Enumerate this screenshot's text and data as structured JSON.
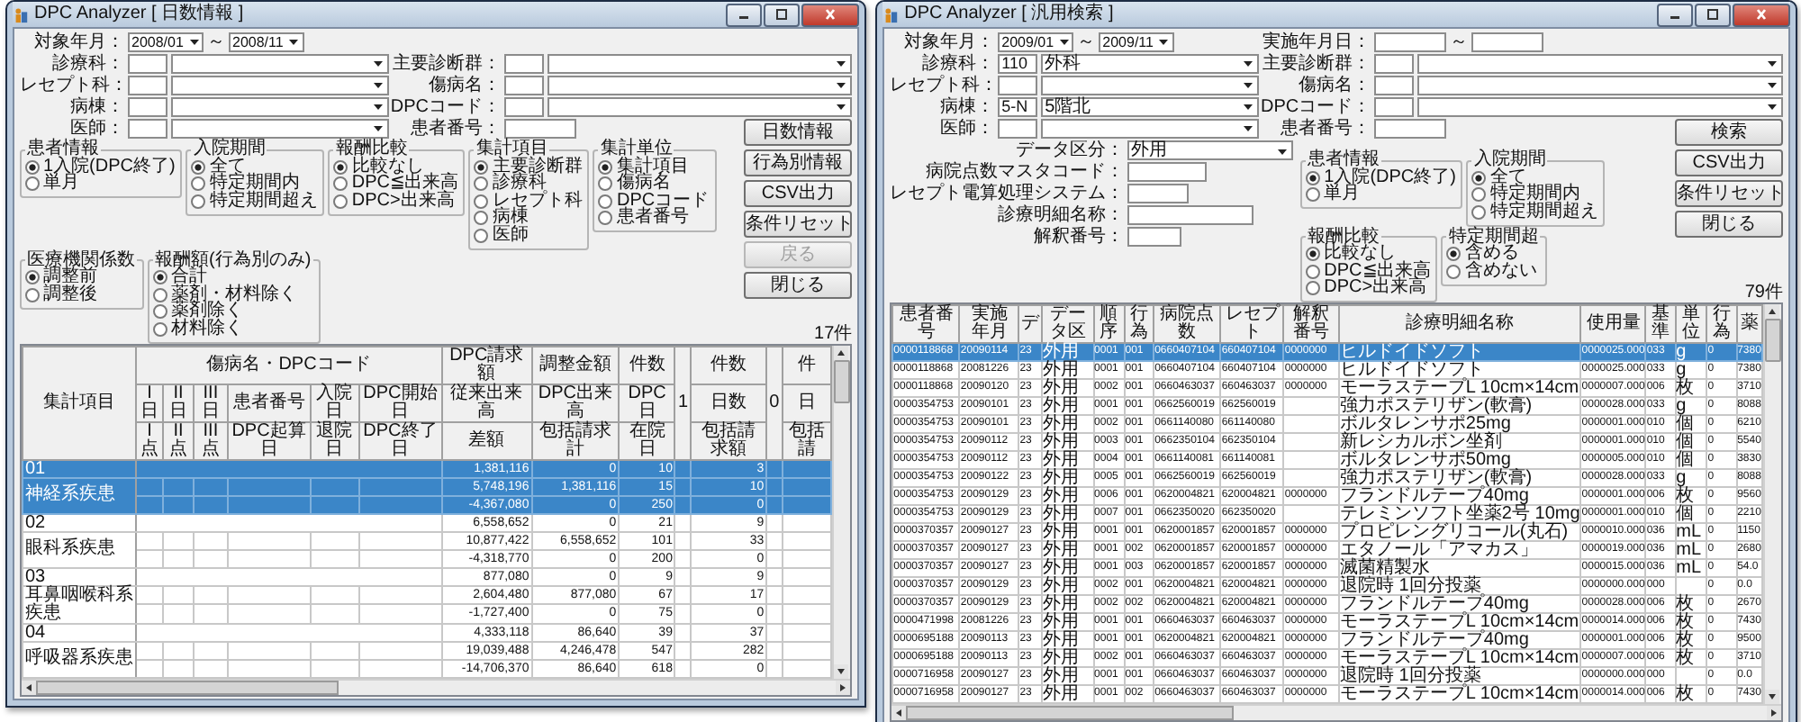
{
  "windows": [
    {
      "title": "DPC Analyzer [ 日数情報 ]",
      "period": {
        "label": "対象年月：",
        "from": "2008/01",
        "sep": "～",
        "to": "2008/11"
      },
      "field_rows": [
        [
          {
            "label": "診療科：",
            "kind": "code_select"
          },
          {
            "label": "主要診断群：",
            "kind": "code_select"
          }
        ],
        [
          {
            "label": "レセプト科：",
            "kind": "code_select"
          },
          {
            "label": "傷病名：",
            "kind": "code_select"
          }
        ],
        [
          {
            "label": "病棟：",
            "kind": "code_select"
          },
          {
            "label": "DPCコード：",
            "kind": "code_select"
          }
        ],
        [
          {
            "label": "医師：",
            "kind": "code_select"
          },
          {
            "label": "患者番号：",
            "kind": "text"
          }
        ]
      ],
      "groups": [
        {
          "title": "患者情報",
          "options": [
            {
              "label": "1入院(DPC終了)",
              "selected": true
            },
            {
              "label": "単月",
              "selected": false
            }
          ]
        },
        {
          "title": "入院期間",
          "options": [
            {
              "label": "全て",
              "selected": true
            },
            {
              "label": "特定期間内",
              "selected": false
            },
            {
              "label": "特定期間超え",
              "selected": false
            }
          ]
        },
        {
          "title": "報酬比較",
          "options": [
            {
              "label": "比較なし",
              "selected": true
            },
            {
              "label": "DPC≦出来高",
              "selected": false
            },
            {
              "label": "DPC>出来高",
              "selected": false
            }
          ]
        },
        {
          "title": "集計項目",
          "options": [
            {
              "label": "主要診断群",
              "selected": true
            },
            {
              "label": "診療科",
              "selected": false
            },
            {
              "label": "レセプト科",
              "selected": false
            },
            {
              "label": "病棟",
              "selected": false
            },
            {
              "label": "医師",
              "selected": false
            }
          ]
        },
        {
          "title": "集計単位",
          "options": [
            {
              "label": "集計項目",
              "selected": true
            },
            {
              "label": "傷病名",
              "selected": false
            },
            {
              "label": "DPCコード",
              "selected": false
            },
            {
              "label": "患者番号",
              "selected": false
            }
          ]
        },
        {
          "title": "医療機関係数",
          "options": [
            {
              "label": "調整前",
              "selected": true
            },
            {
              "label": "調整後",
              "selected": false
            }
          ]
        },
        {
          "title": "報酬額(行為別のみ)",
          "options": [
            {
              "label": "合計",
              "selected": true
            },
            {
              "label": "薬剤・材料除く",
              "selected": false
            },
            {
              "label": "薬剤除く",
              "selected": false
            },
            {
              "label": "材料除く",
              "selected": false
            }
          ]
        }
      ],
      "buttons": [
        {
          "label": "日数情報",
          "disabled": false
        },
        {
          "label": "行為別情報",
          "disabled": false
        },
        {
          "label": "CSV出力",
          "disabled": false
        },
        {
          "label": "条件リセット",
          "disabled": false
        },
        {
          "label": "戻る",
          "disabled": true
        },
        {
          "label": "閉じる",
          "disabled": false
        }
      ],
      "count": "17件",
      "table": {
        "kind": "summary",
        "header_rows": [
          [
            "集計項目",
            "傷病名・DPCコード",
            "DPC請求額",
            "調整金額",
            "件数",
            "1",
            "件数",
            "0",
            "件"
          ],
          [
            "I日",
            "II日",
            "III日",
            "患者番号",
            "入院日",
            "DPC開始日",
            "従来出来高",
            "DPC出来高",
            "DPC日",
            "日数",
            "日"
          ],
          [
            "I点",
            "II点",
            "III点",
            "DPC起算日",
            "退院日",
            "DPC終了日",
            "差額",
            "包括請求計",
            "在院日",
            "包括請求額",
            "包括請"
          ]
        ],
        "groups": [
          {
            "code": "01",
            "name": "神経系疾患",
            "selected": true,
            "rows": [
              [
                "1,381,116",
                "0",
                "10",
                "3"
              ],
              [
                "5,748,196",
                "1,381,116",
                "15",
                "10"
              ],
              [
                "-4,367,080",
                "0",
                "250",
                "0"
              ]
            ]
          },
          {
            "code": "02",
            "name": "眼科系疾患",
            "selected": false,
            "rows": [
              [
                "6,558,652",
                "0",
                "21",
                "9"
              ],
              [
                "10,877,422",
                "6,558,652",
                "101",
                "33"
              ],
              [
                "-4,318,770",
                "0",
                "200",
                "0"
              ]
            ]
          },
          {
            "code": "03",
            "name": "耳鼻咽喉科系疾患",
            "selected": false,
            "rows": [
              [
                "877,080",
                "0",
                "9",
                "9"
              ],
              [
                "2,604,480",
                "877,080",
                "67",
                "17"
              ],
              [
                "-1,727,400",
                "0",
                "75",
                "0"
              ]
            ]
          },
          {
            "code": "04",
            "name": "呼吸器系疾患",
            "selected": false,
            "rows": [
              [
                "4,333,118",
                "86,640",
                "39",
                "37"
              ],
              [
                "19,039,488",
                "4,246,478",
                "547",
                "282"
              ],
              [
                "-14,706,370",
                "86,640",
                "618",
                "0"
              ]
            ]
          }
        ]
      }
    },
    {
      "title": "DPC Analyzer [ 汎用検索 ]",
      "period": {
        "label": "対象年月：",
        "from": "2009/01",
        "sep": "～",
        "to": "2009/11"
      },
      "date_range": {
        "label": "実施年月日：",
        "sep": "～"
      },
      "field_rows": [
        [
          {
            "label": "診療科：",
            "kind": "code_select",
            "code": "110",
            "value": "外科"
          },
          {
            "label": "主要診断群：",
            "kind": "code_select"
          }
        ],
        [
          {
            "label": "レセプト科：",
            "kind": "code_select"
          },
          {
            "label": "傷病名：",
            "kind": "code_select"
          }
        ],
        [
          {
            "label": "病棟：",
            "kind": "code_select",
            "code": "5-N",
            "value": "5階北"
          },
          {
            "label": "DPCコード：",
            "kind": "code_select"
          }
        ],
        [
          {
            "label": "医師：",
            "kind": "code_select"
          },
          {
            "label": "患者番号：",
            "kind": "text"
          }
        ]
      ],
      "extra_fields": [
        {
          "label": "データ区分：",
          "kind": "select",
          "value": "外用"
        },
        {
          "label": "病院点数マスタコード：",
          "kind": "text"
        },
        {
          "label": "レセプト電算処理システム：",
          "kind": "text"
        },
        {
          "label": "診療明細名称：",
          "kind": "text"
        },
        {
          "label": "解釈番号：",
          "kind": "text"
        }
      ],
      "groups": [
        {
          "title": "患者情報",
          "options": [
            {
              "label": "1入院(DPC終了)",
              "selected": true
            },
            {
              "label": "単月",
              "selected": false
            }
          ]
        },
        {
          "title": "入院期間",
          "options": [
            {
              "label": "全て",
              "selected": true
            },
            {
              "label": "特定期間内",
              "selected": false
            },
            {
              "label": "特定期間超え",
              "selected": false
            }
          ]
        },
        {
          "title": "報酬比較",
          "options": [
            {
              "label": "比較なし",
              "selected": true
            },
            {
              "label": "DPC≦出来高",
              "selected": false
            },
            {
              "label": "DPC>出来高",
              "selected": false
            }
          ]
        },
        {
          "title": "特定期間超",
          "options": [
            {
              "label": "含める",
              "selected": true
            },
            {
              "label": "含めない",
              "selected": false
            }
          ]
        }
      ],
      "buttons": [
        {
          "label": "検索",
          "disabled": false
        },
        {
          "label": "CSV出力",
          "disabled": false
        },
        {
          "label": "条件リセット",
          "disabled": false
        },
        {
          "label": "閉じる",
          "disabled": false
        }
      ],
      "count": "79件",
      "table": {
        "kind": "list",
        "columns": {
          "patient_no": "患者番号",
          "date": "実施年月",
          "column_3": "デ",
          "data_type": "データ区",
          "order": "順序",
          "act": "行為",
          "hospital_points": "病院点数",
          "receipt": "レセプト",
          "interpretation_no": "解釈番号",
          "item_name": "診療明細名称",
          "amount": "使用量",
          "standard": "基準",
          "unit": "単位",
          "act_2": "行為",
          "column_15": "薬"
        },
        "rows": [
          {
            "selected": true,
            "patient_no": "0000118868",
            "date": "20090114",
            "column_3": "23",
            "data_type": "外用",
            "order": "0001",
            "act": "001",
            "hospital_points": "0660407104",
            "receipt": "660407104",
            "interpretation_no": "0000000",
            "item_name": "ヒルドイドソフト",
            "amount": "0000025.000",
            "standard": "033",
            "unit": "g",
            "act_2": "0",
            "column_15": "7380"
          },
          {
            "selected": false,
            "patient_no": "0000118868",
            "date": "20081226",
            "column_3": "23",
            "data_type": "外用",
            "order": "0001",
            "act": "001",
            "hospital_points": "0660407104",
            "receipt": "660407104",
            "interpretation_no": "0000000",
            "item_name": "ヒルドイドソフト",
            "amount": "0000025.000",
            "standard": "033",
            "unit": "g",
            "act_2": "0",
            "column_15": "7380"
          },
          {
            "selected": false,
            "patient_no": "0000118868",
            "date": "20090120",
            "column_3": "23",
            "data_type": "外用",
            "order": "0002",
            "act": "001",
            "hospital_points": "0660463037",
            "receipt": "660463037",
            "interpretation_no": "0000000",
            "item_name": "モーラステープL 10cm×14cm",
            "amount": "0000007.000",
            "standard": "006",
            "unit": "枚",
            "act_2": "0",
            "column_15": "3710"
          },
          {
            "selected": false,
            "patient_no": "0000354753",
            "date": "20090101",
            "column_3": "23",
            "data_type": "外用",
            "order": "0001",
            "act": "001",
            "hospital_points": "0662560019",
            "receipt": "662560019",
            "item_name": "強力ポステリザン(軟膏)",
            "amount": "0000028.000",
            "standard": "033",
            "unit": "g",
            "act_2": "0",
            "column_15": "8088"
          },
          {
            "selected": false,
            "patient_no": "0000354753",
            "date": "20090101",
            "column_3": "23",
            "data_type": "外用",
            "order": "0002",
            "act": "001",
            "hospital_points": "0661140080",
            "receipt": "661140080",
            "item_name": "ボルタレンサポ25mg",
            "amount": "0000001.000",
            "standard": "010",
            "unit": "個",
            "act_2": "0",
            "column_15": "6210"
          },
          {
            "selected": false,
            "patient_no": "0000354753",
            "date": "20090112",
            "column_3": "23",
            "data_type": "外用",
            "order": "0003",
            "act": "001",
            "hospital_points": "0662350104",
            "receipt": "662350104",
            "item_name": "新レシカルボン坐剤",
            "amount": "0000001.000",
            "standard": "010",
            "unit": "個",
            "act_2": "0",
            "column_15": "5540"
          },
          {
            "selected": false,
            "patient_no": "0000354753",
            "date": "20090112",
            "column_3": "23",
            "data_type": "外用",
            "order": "0004",
            "act": "001",
            "hospital_points": "0661140081",
            "receipt": "661140081",
            "item_name": "ボルタレンサポ50mg",
            "amount": "0000005.000",
            "standard": "010",
            "unit": "個",
            "act_2": "0",
            "column_15": "3830"
          },
          {
            "selected": false,
            "patient_no": "0000354753",
            "date": "20090122",
            "column_3": "23",
            "data_type": "外用",
            "order": "0005",
            "act": "001",
            "hospital_points": "0662560019",
            "receipt": "662560019",
            "item_name": "強力ポステリザン(軟膏)",
            "amount": "0000028.000",
            "standard": "033",
            "unit": "g",
            "act_2": "0",
            "column_15": "8088"
          },
          {
            "selected": false,
            "patient_no": "0000354753",
            "date": "20090129",
            "column_3": "23",
            "data_type": "外用",
            "order": "0006",
            "act": "001",
            "hospital_points": "0620004821",
            "receipt": "620004821",
            "interpretation_no": "0000000",
            "item_name": "フランドルテープ40mg",
            "amount": "0000001.000",
            "standard": "006",
            "unit": "枚",
            "act_2": "0",
            "column_15": "9560"
          },
          {
            "selected": false,
            "patient_no": "0000354753",
            "date": "20090129",
            "column_3": "23",
            "data_type": "外用",
            "order": "0007",
            "act": "001",
            "hospital_points": "0662350020",
            "receipt": "662350020",
            "item_name": "テレミンソフト坐薬2号 10mg",
            "amount": "0000001.000",
            "standard": "010",
            "unit": "個",
            "act_2": "0",
            "column_15": "2210"
          },
          {
            "selected": false,
            "patient_no": "0000370357",
            "date": "20090127",
            "column_3": "23",
            "data_type": "外用",
            "order": "0001",
            "act": "001",
            "hospital_points": "0620001857",
            "receipt": "620001857",
            "interpretation_no": "0000000",
            "item_name": "プロピレングリコール(丸石)",
            "amount": "0000010.000",
            "standard": "036",
            "unit": "mL",
            "act_2": "0",
            "column_15": "1150"
          },
          {
            "selected": false,
            "patient_no": "0000370357",
            "date": "20090127",
            "column_3": "23",
            "data_type": "外用",
            "order": "0001",
            "act": "002",
            "hospital_points": "0620001857",
            "receipt": "620001857",
            "interpretation_no": "0000000",
            "item_name": "エタノール「アマカス」",
            "amount": "0000019.000",
            "standard": "036",
            "unit": "mL",
            "act_2": "0",
            "column_15": "2680"
          },
          {
            "selected": false,
            "patient_no": "0000370357",
            "date": "20090127",
            "column_3": "23",
            "data_type": "外用",
            "order": "0001",
            "act": "003",
            "hospital_points": "0620001857",
            "receipt": "620001857",
            "interpretation_no": "0000000",
            "item_name": "滅菌精製水",
            "amount": "0000015.000",
            "standard": "036",
            "unit": "mL",
            "act_2": "0",
            "column_15": "54.0"
          },
          {
            "selected": false,
            "patient_no": "0000370357",
            "date": "20090129",
            "column_3": "23",
            "data_type": "外用",
            "order": "0002",
            "act": "001",
            "hospital_points": "0620004821",
            "receipt": "620004821",
            "interpretation_no": "0000000",
            "item_name": "退院時 1回分投薬",
            "amount": "0000000.000",
            "standard": "000",
            "act_2": "0",
            "column_15": "0.0"
          },
          {
            "selected": false,
            "patient_no": "0000370357",
            "date": "20090129",
            "column_3": "23",
            "data_type": "外用",
            "order": "0002",
            "act": "002",
            "hospital_points": "0620004821",
            "receipt": "620004821",
            "interpretation_no": "0000000",
            "item_name": "フランドルテープ40mg",
            "amount": "0000028.000",
            "standard": "006",
            "unit": "枚",
            "act_2": "0",
            "column_15": "2670"
          },
          {
            "selected": false,
            "patient_no": "0000471998",
            "date": "20081226",
            "column_3": "23",
            "data_type": "外用",
            "order": "0001",
            "act": "001",
            "hospital_points": "0660463037",
            "receipt": "660463037",
            "interpretation_no": "0000000",
            "item_name": "モーラステープL 10cm×14cm",
            "amount": "0000014.000",
            "standard": "006",
            "unit": "枚",
            "act_2": "0",
            "column_15": "7430"
          },
          {
            "selected": false,
            "patient_no": "0000695188",
            "date": "20090113",
            "column_3": "23",
            "data_type": "外用",
            "order": "0001",
            "act": "001",
            "hospital_points": "0620004821",
            "receipt": "620004821",
            "interpretation_no": "0000000",
            "item_name": "フランドルテープ40mg",
            "amount": "0000001.000",
            "standard": "006",
            "unit": "枚",
            "act_2": "0",
            "column_15": "9500"
          },
          {
            "selected": false,
            "patient_no": "0000695188",
            "date": "20090113",
            "column_3": "23",
            "data_type": "外用",
            "order": "0002",
            "act": "001",
            "hospital_points": "0660463037",
            "receipt": "660463037",
            "interpretation_no": "0000000",
            "item_name": "モーラステープL 10cm×14cm",
            "amount": "0000007.000",
            "standard": "006",
            "unit": "枚",
            "act_2": "0",
            "column_15": "3710"
          },
          {
            "selected": false,
            "patient_no": "0000716958",
            "date": "20090127",
            "column_3": "23",
            "data_type": "外用",
            "order": "0001",
            "act": "001",
            "hospital_points": "0660463037",
            "receipt": "660463037",
            "interpretation_no": "0000000",
            "item_name": "退院時 1回分投薬",
            "amount": "0000000.000",
            "standard": "000",
            "act_2": "0",
            "column_15": "0.0"
          },
          {
            "selected": false,
            "patient_no": "0000716958",
            "date": "20090127",
            "column_3": "23",
            "data_type": "外用",
            "order": "0001",
            "act": "002",
            "hospital_points": "0660463037",
            "receipt": "660463037",
            "interpretation_no": "0000000",
            "item_name": "モーラステープL 10cm×14cm",
            "amount": "0000014.000",
            "standard": "006",
            "unit": "枚",
            "act_2": "0",
            "column_15": "7430"
          }
        ]
      }
    }
  ]
}
